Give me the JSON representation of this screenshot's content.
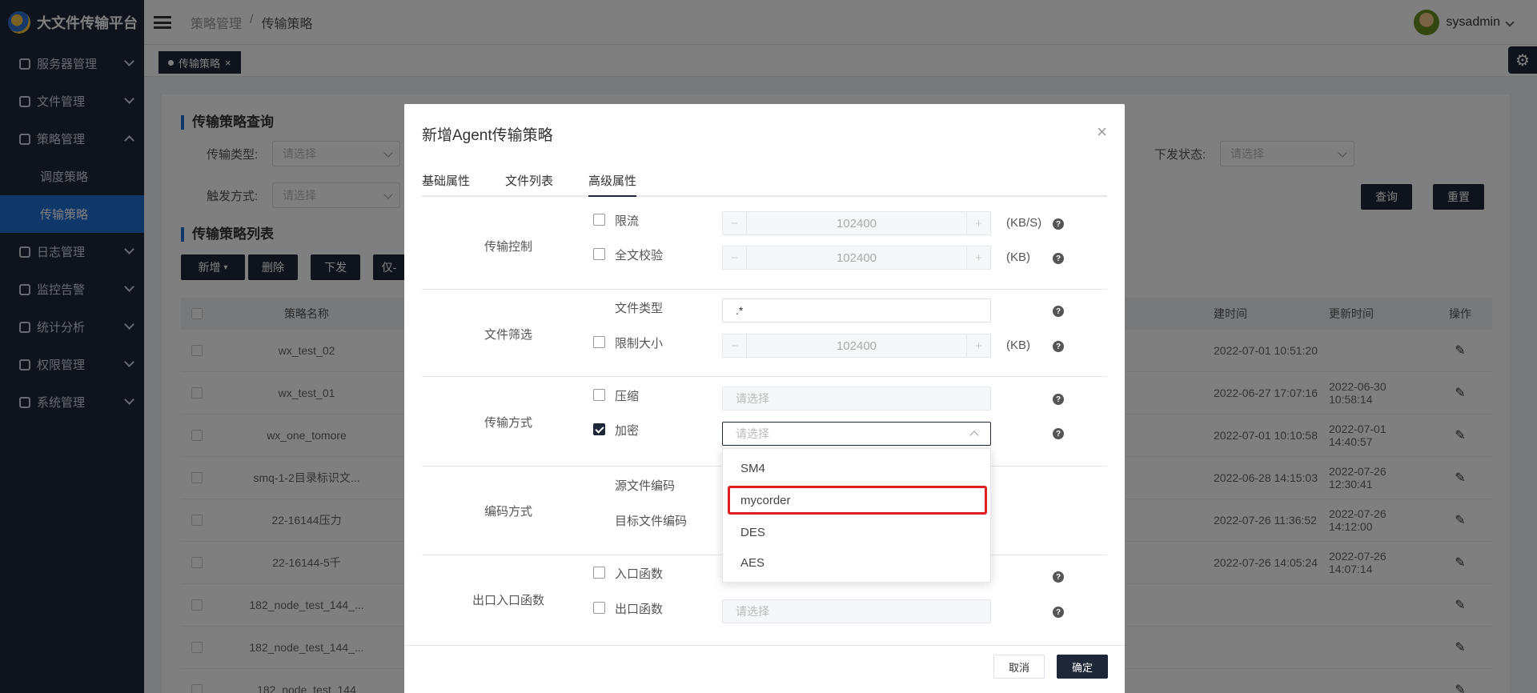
{
  "app": {
    "title": "大文件传输平台"
  },
  "sidebar": {
    "items": [
      {
        "label": "服务器管理"
      },
      {
        "label": "文件管理"
      },
      {
        "label": "策略管理",
        "children": [
          {
            "label": "调度策略"
          },
          {
            "label": "传输策略"
          }
        ]
      },
      {
        "label": "日志管理"
      },
      {
        "label": "监控告警"
      },
      {
        "label": "统计分析"
      },
      {
        "label": "权限管理"
      },
      {
        "label": "系统管理"
      }
    ]
  },
  "topbar": {
    "breadcrumb": [
      "策略管理",
      "/",
      "传输策略"
    ],
    "user": "sysadmin"
  },
  "tabs": [
    {
      "label": "传输策略",
      "close": "×"
    }
  ],
  "query": {
    "title": "传输策略查询",
    "type_label": "传输类型:",
    "trigger_label": "触发方式:",
    "status_label": "下发状态:",
    "placeholder": "请选择",
    "search_button": "查询",
    "reset_button": "重置"
  },
  "list": {
    "title": "传输策略列表",
    "buttons": {
      "add": "新增",
      "delete": "删除",
      "issue": "下发",
      "only": "仅-"
    },
    "columns": {
      "name": "策略名称",
      "created": "建时间",
      "updated": "更新时间",
      "ops": "操作"
    },
    "rows": [
      {
        "name": "wx_test_02",
        "created": "2022-07-01 10:51:20",
        "updated": ""
      },
      {
        "name": "wx_test_01",
        "created": "2022-06-27 17:07:16",
        "updated": "2022-06-30 10:58:14"
      },
      {
        "name": "wx_one_tomore",
        "created": "2022-07-01 10:10:58",
        "updated": "2022-07-01 14:40:57"
      },
      {
        "name": "smq-1-2目录标识文...",
        "created": "2022-06-28 14:15:03",
        "updated": "2022-07-26 12:30:41"
      },
      {
        "name": "22-16144压力",
        "created": "2022-07-26 11:36:52",
        "updated": "2022-07-26 14:12:00"
      },
      {
        "name": "22-16144-5千",
        "created": "2022-07-26 14:05:24",
        "updated": "2022-07-26 14:07:14"
      },
      {
        "name": "182_node_test_144_...",
        "created": "",
        "updated": ""
      },
      {
        "name": "182_node_test_144_...",
        "created": "",
        "updated": ""
      },
      {
        "name": "182_node_test_144",
        "created": "",
        "updated": ""
      }
    ]
  },
  "modal": {
    "title": "新增Agent传输策略",
    "close": "×",
    "tabs": [
      {
        "label": "基础属性"
      },
      {
        "label": "文件列表"
      },
      {
        "label": "高级属性"
      }
    ],
    "groups": {
      "transfer_control": "传输控制",
      "file_filter": "文件筛选",
      "transfer_mode": "传输方式",
      "encoding": "编码方式",
      "io_functions": "出口入口函数"
    },
    "fields": {
      "rate_limit": {
        "label": "限流",
        "value": "102400",
        "unit": "(KB/S)",
        "checked": false
      },
      "full_verify": {
        "label": "全文校验",
        "value": "102400",
        "unit": "(KB)",
        "checked": false
      },
      "file_type": {
        "label": "文件类型",
        "value": ".*"
      },
      "size_limit": {
        "label": "限制大小",
        "value": "102400",
        "unit": "(KB)",
        "checked": false
      },
      "compress": {
        "label": "压缩",
        "placeholder": "请选择",
        "checked": false
      },
      "encrypt": {
        "label": "加密",
        "placeholder": "请选择",
        "checked": true
      },
      "src_encoding": {
        "label": "源文件编码"
      },
      "dst_encoding": {
        "label": "目标文件编码"
      },
      "entry_func": {
        "label": "入口函数",
        "checked": false
      },
      "exit_func": {
        "label": "出口函数",
        "placeholder": "请选择",
        "checked": false
      }
    },
    "stepper": {
      "minus": "−",
      "plus": "+"
    },
    "help": "?",
    "encrypt_options": [
      {
        "label": "SM4"
      },
      {
        "label": "mycorder",
        "highlighted": true
      },
      {
        "label": "DES"
      },
      {
        "label": "AES"
      }
    ],
    "cancel": "取消",
    "confirm": "确定"
  },
  "colors": {
    "sidebar": "#1d2738",
    "active": "#1f6fd3",
    "highlight": "#e02020"
  }
}
